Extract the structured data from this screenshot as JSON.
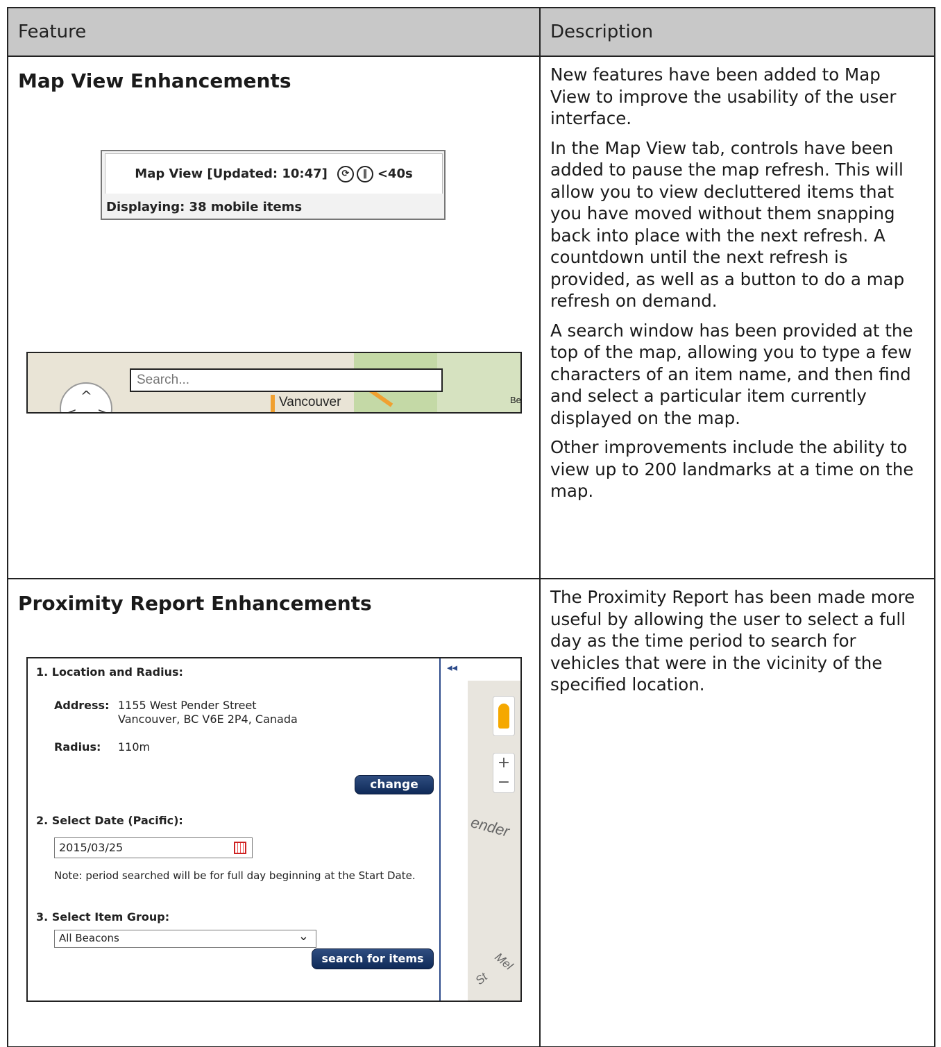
{
  "table": {
    "header_feature": "Feature",
    "header_description": "Description"
  },
  "row1": {
    "title": "Map View Enhancements",
    "map_view_widget": {
      "tab_title": "Map View [Updated: 10:47]",
      "refresh_icon": "refresh-icon",
      "pause_icon": "pause-icon",
      "countdown": "<40s",
      "footer": "Displaying: 38 mobile items"
    },
    "search_strip": {
      "search_placeholder": "Search...",
      "city_label": "Vancouver",
      "edge_label": "Be"
    },
    "paragraphs": [
      "New features have been added to Map View to improve the usability of the user interface.",
      "In the Map View tab, controls have been added to pause the map refresh. This will allow you to view decluttered items that you have moved without them snapping back into place with the next refresh. A countdown until the next refresh is provided, as well as a button to do a map refresh on demand.",
      "A search window has been provided at the top of the map, allowing you to type a few characters of an item name, and then find and select a particular item currently displayed on the map.",
      "Other improvements include the ability to view up to 200 landmarks at a time on the map."
    ]
  },
  "row2": {
    "title": "Proximity Report Enhancements",
    "panel": {
      "section1": "1. Location and Radius:",
      "address_label": "Address:",
      "address_line1": "1155 West Pender Street",
      "address_line2": "Vancouver, BC V6E 2P4, Canada",
      "radius_label": "Radius:",
      "radius_value": "110m",
      "change_button": "change",
      "section2": "2. Select Date (Pacific):",
      "date_value": "2015/03/25",
      "note": "Note: period searched will be for full day beginning at the Start Date.",
      "section3": "3. Select Item Group:",
      "group_value": "All Beacons",
      "search_button": "search for items",
      "map_text_1": "ender",
      "map_text_2": "St",
      "map_text_3": "Mel"
    },
    "paragraphs": [
      "The Proximity Report has been made more useful by allowing the user to select a full day as the time period to search for vehicles that were in the vicinity of the specified location."
    ]
  }
}
